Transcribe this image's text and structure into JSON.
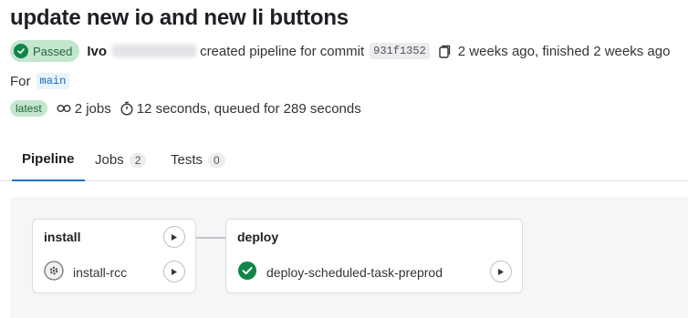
{
  "title": "update new io and new li buttons",
  "status": {
    "label": "Passed"
  },
  "user": {
    "name": "Ivo"
  },
  "pipeline": {
    "created_text": "created pipeline for commit",
    "commit_sha": "931f1352",
    "time_text": "2 weeks ago, finished 2 weeks ago"
  },
  "ref": {
    "prefix": "For",
    "name": "main"
  },
  "stats": {
    "latest_label": "latest",
    "jobs_text": "2 jobs",
    "duration_text": "12 seconds, queued for 289 seconds"
  },
  "tabs": [
    {
      "label": "Pipeline"
    },
    {
      "label": "Jobs",
      "count": "2"
    },
    {
      "label": "Tests",
      "count": "0"
    }
  ],
  "stages": [
    {
      "name": "install",
      "jobs": [
        {
          "name": "install-rcc",
          "status": "created"
        }
      ]
    },
    {
      "name": "deploy",
      "jobs": [
        {
          "name": "deploy-scheduled-task-preprod",
          "status": "success"
        }
      ]
    }
  ],
  "colors": {
    "success": "#108548",
    "link": "#1f75cb"
  },
  "icons": [
    "check-circle-icon",
    "copy-icon",
    "jobs-icon",
    "timer-icon",
    "play-icon",
    "gear-status-icon"
  ]
}
